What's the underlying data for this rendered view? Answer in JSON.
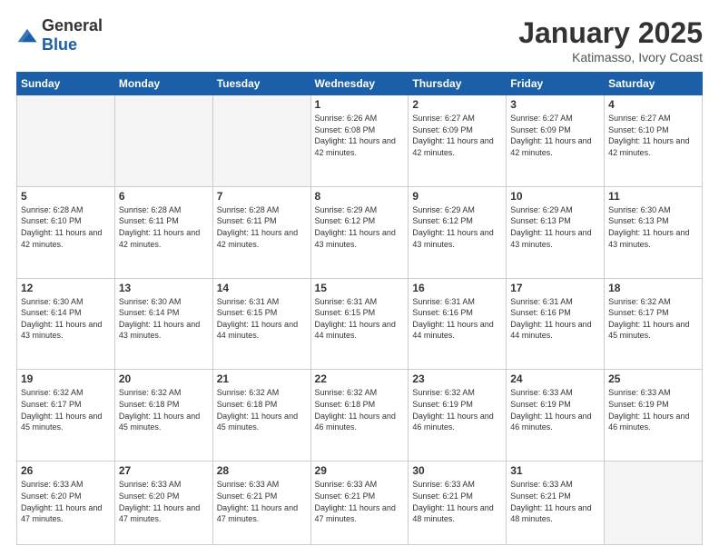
{
  "header": {
    "logo_general": "General",
    "logo_blue": "Blue",
    "month": "January 2025",
    "location": "Katimasso, Ivory Coast"
  },
  "weekdays": [
    "Sunday",
    "Monday",
    "Tuesday",
    "Wednesday",
    "Thursday",
    "Friday",
    "Saturday"
  ],
  "weeks": [
    [
      {
        "day": "",
        "info": ""
      },
      {
        "day": "",
        "info": ""
      },
      {
        "day": "",
        "info": ""
      },
      {
        "day": "1",
        "info": "Sunrise: 6:26 AM\nSunset: 6:08 PM\nDaylight: 11 hours and 42 minutes."
      },
      {
        "day": "2",
        "info": "Sunrise: 6:27 AM\nSunset: 6:09 PM\nDaylight: 11 hours and 42 minutes."
      },
      {
        "day": "3",
        "info": "Sunrise: 6:27 AM\nSunset: 6:09 PM\nDaylight: 11 hours and 42 minutes."
      },
      {
        "day": "4",
        "info": "Sunrise: 6:27 AM\nSunset: 6:10 PM\nDaylight: 11 hours and 42 minutes."
      }
    ],
    [
      {
        "day": "5",
        "info": "Sunrise: 6:28 AM\nSunset: 6:10 PM\nDaylight: 11 hours and 42 minutes."
      },
      {
        "day": "6",
        "info": "Sunrise: 6:28 AM\nSunset: 6:11 PM\nDaylight: 11 hours and 42 minutes."
      },
      {
        "day": "7",
        "info": "Sunrise: 6:28 AM\nSunset: 6:11 PM\nDaylight: 11 hours and 42 minutes."
      },
      {
        "day": "8",
        "info": "Sunrise: 6:29 AM\nSunset: 6:12 PM\nDaylight: 11 hours and 43 minutes."
      },
      {
        "day": "9",
        "info": "Sunrise: 6:29 AM\nSunset: 6:12 PM\nDaylight: 11 hours and 43 minutes."
      },
      {
        "day": "10",
        "info": "Sunrise: 6:29 AM\nSunset: 6:13 PM\nDaylight: 11 hours and 43 minutes."
      },
      {
        "day": "11",
        "info": "Sunrise: 6:30 AM\nSunset: 6:13 PM\nDaylight: 11 hours and 43 minutes."
      }
    ],
    [
      {
        "day": "12",
        "info": "Sunrise: 6:30 AM\nSunset: 6:14 PM\nDaylight: 11 hours and 43 minutes."
      },
      {
        "day": "13",
        "info": "Sunrise: 6:30 AM\nSunset: 6:14 PM\nDaylight: 11 hours and 43 minutes."
      },
      {
        "day": "14",
        "info": "Sunrise: 6:31 AM\nSunset: 6:15 PM\nDaylight: 11 hours and 44 minutes."
      },
      {
        "day": "15",
        "info": "Sunrise: 6:31 AM\nSunset: 6:15 PM\nDaylight: 11 hours and 44 minutes."
      },
      {
        "day": "16",
        "info": "Sunrise: 6:31 AM\nSunset: 6:16 PM\nDaylight: 11 hours and 44 minutes."
      },
      {
        "day": "17",
        "info": "Sunrise: 6:31 AM\nSunset: 6:16 PM\nDaylight: 11 hours and 44 minutes."
      },
      {
        "day": "18",
        "info": "Sunrise: 6:32 AM\nSunset: 6:17 PM\nDaylight: 11 hours and 45 minutes."
      }
    ],
    [
      {
        "day": "19",
        "info": "Sunrise: 6:32 AM\nSunset: 6:17 PM\nDaylight: 11 hours and 45 minutes."
      },
      {
        "day": "20",
        "info": "Sunrise: 6:32 AM\nSunset: 6:18 PM\nDaylight: 11 hours and 45 minutes."
      },
      {
        "day": "21",
        "info": "Sunrise: 6:32 AM\nSunset: 6:18 PM\nDaylight: 11 hours and 45 minutes."
      },
      {
        "day": "22",
        "info": "Sunrise: 6:32 AM\nSunset: 6:18 PM\nDaylight: 11 hours and 46 minutes."
      },
      {
        "day": "23",
        "info": "Sunrise: 6:32 AM\nSunset: 6:19 PM\nDaylight: 11 hours and 46 minutes."
      },
      {
        "day": "24",
        "info": "Sunrise: 6:33 AM\nSunset: 6:19 PM\nDaylight: 11 hours and 46 minutes."
      },
      {
        "day": "25",
        "info": "Sunrise: 6:33 AM\nSunset: 6:19 PM\nDaylight: 11 hours and 46 minutes."
      }
    ],
    [
      {
        "day": "26",
        "info": "Sunrise: 6:33 AM\nSunset: 6:20 PM\nDaylight: 11 hours and 47 minutes."
      },
      {
        "day": "27",
        "info": "Sunrise: 6:33 AM\nSunset: 6:20 PM\nDaylight: 11 hours and 47 minutes."
      },
      {
        "day": "28",
        "info": "Sunrise: 6:33 AM\nSunset: 6:21 PM\nDaylight: 11 hours and 47 minutes."
      },
      {
        "day": "29",
        "info": "Sunrise: 6:33 AM\nSunset: 6:21 PM\nDaylight: 11 hours and 47 minutes."
      },
      {
        "day": "30",
        "info": "Sunrise: 6:33 AM\nSunset: 6:21 PM\nDaylight: 11 hours and 48 minutes."
      },
      {
        "day": "31",
        "info": "Sunrise: 6:33 AM\nSunset: 6:21 PM\nDaylight: 11 hours and 48 minutes."
      },
      {
        "day": "",
        "info": ""
      }
    ]
  ]
}
